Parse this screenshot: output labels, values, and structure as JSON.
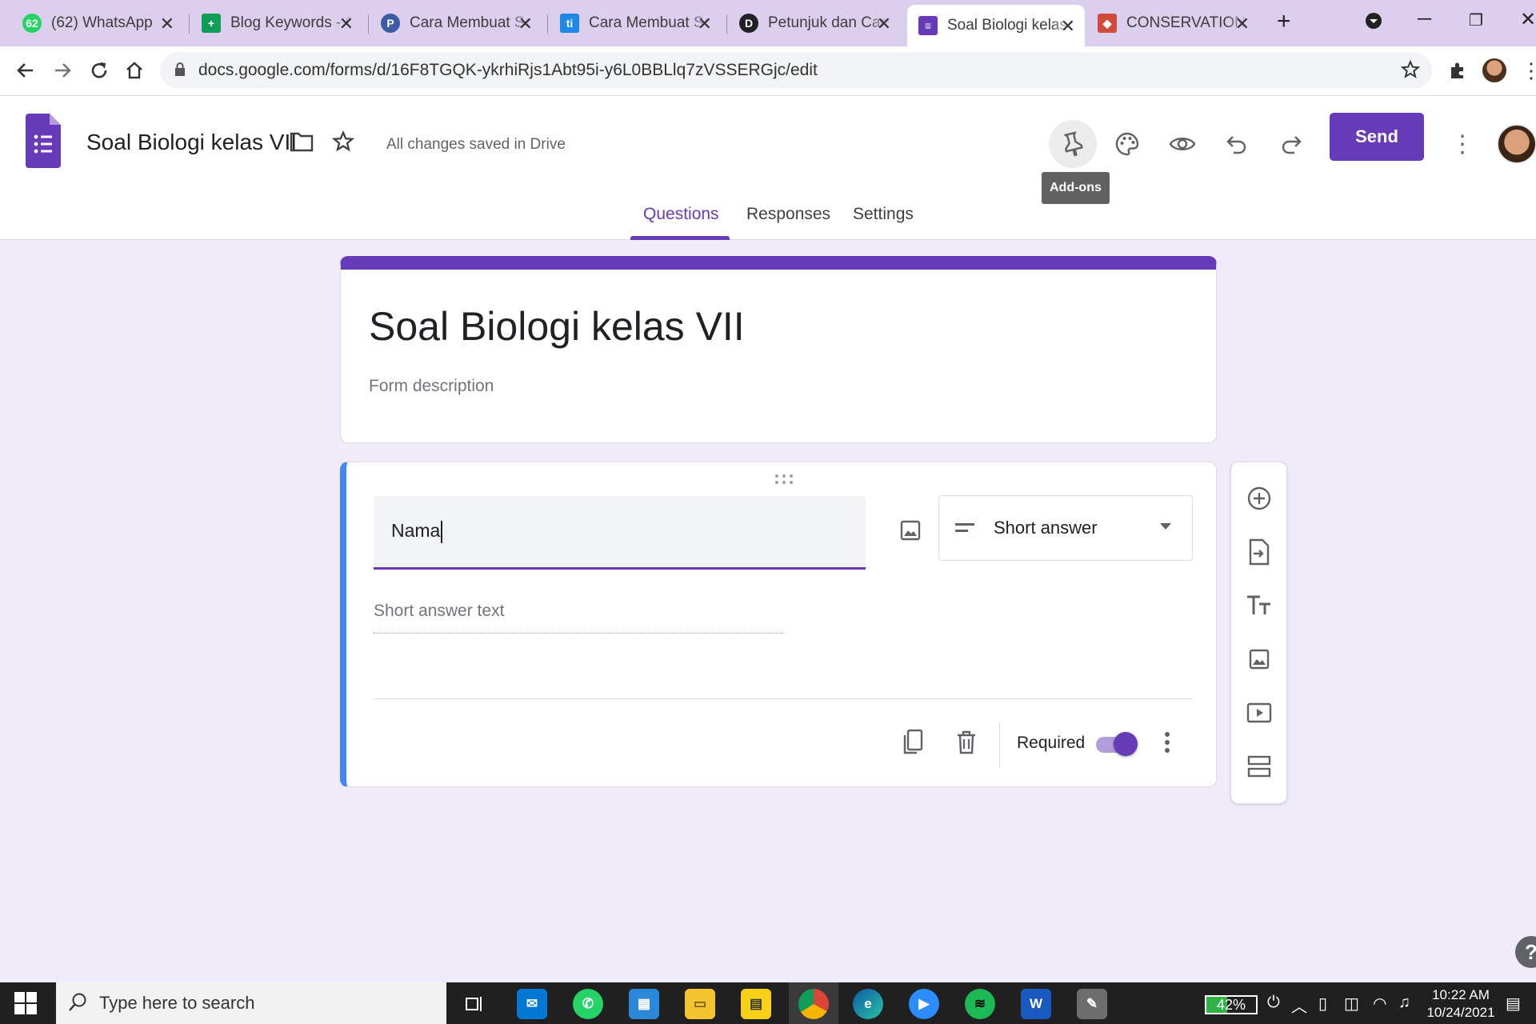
{
  "browser": {
    "tabs": [
      {
        "title": "(62) WhatsApp",
        "favicon_text": "62",
        "favicon_color": "#25d366"
      },
      {
        "title": "Blog Keywords - Google Sheets",
        "favicon_text": "+",
        "favicon_color": "#0f9d58"
      },
      {
        "title": "Cara Membuat Soal",
        "favicon_text": "P",
        "favicon_color": "#3b5ba5"
      },
      {
        "title": "Cara Membuat Soal",
        "favicon_text": "ti",
        "favicon_color": "#1e88e5"
      },
      {
        "title": "Petunjuk dan Cara",
        "favicon_text": "D",
        "favicon_color": "#202124"
      },
      {
        "title": "Soal Biologi kelas VII",
        "favicon_text": "≡",
        "favicon_color": "#673ab7"
      },
      {
        "title": "CONSERVATION",
        "favicon_text": "◆",
        "favicon_color": "#d14b3c"
      }
    ],
    "url": "docs.google.com/forms/d/16F8TGQK-ykrhiRjs1Abt95i-y6L0BBLlq7zVSSERGjc/edit"
  },
  "header": {
    "doc_title": "Soal Biologi kelas VII",
    "save_status": "All changes saved in Drive",
    "send_label": "Send",
    "tooltip": "Add-ons",
    "tabs": [
      {
        "label": "Questions",
        "active": true
      },
      {
        "label": "Responses",
        "active": false
      },
      {
        "label": "Settings",
        "active": false
      }
    ]
  },
  "form": {
    "title": "Soal Biologi kelas VII",
    "description_placeholder": "Form description",
    "accent_color": "#673ab7"
  },
  "question": {
    "title": "Nama",
    "type": "Short answer",
    "answer_placeholder": "Short answer text",
    "required_label": "Required",
    "required": true
  },
  "side_toolbar": [
    "add-question",
    "import-questions",
    "add-title",
    "add-image",
    "add-video",
    "add-section"
  ],
  "taskbar": {
    "search_placeholder": "Type here to search",
    "battery": "42%",
    "time": "10:22 AM",
    "date": "10/24/2021"
  }
}
